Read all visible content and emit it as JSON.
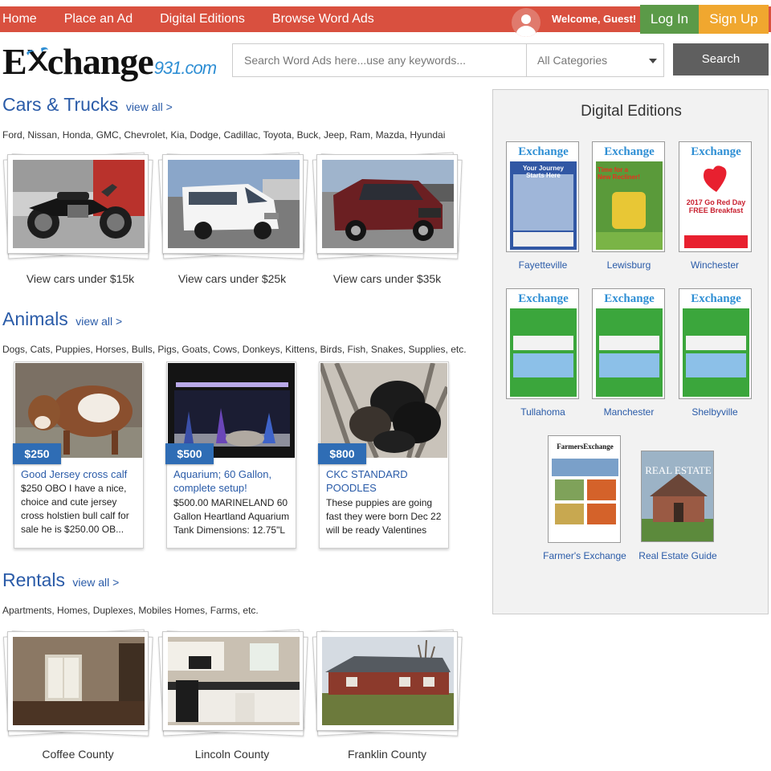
{
  "nav": {
    "items": [
      "Home",
      "Place an Ad",
      "Digital Editions",
      "Browse Word Ads"
    ],
    "welcome": "Welcome, Guest!",
    "login": "Log In",
    "signup": "Sign Up"
  },
  "header": {
    "logo_main_1": "E",
    "logo_main_2": "change",
    "logo_sub": "931.com",
    "search_placeholder": "Search Word Ads here...use any keywords...",
    "category_selected": "All Categories",
    "search_button": "Search"
  },
  "cars": {
    "title": "Cars & Trucks",
    "view_all": "view all >",
    "subtitle": "Ford, Nissan, Honda, GMC, Chevrolet, Kia, Dodge, Cadillac, Toyota, Buck, Jeep, Ram, Mazda, Hyundai",
    "captions": [
      "View cars under $15k",
      "View cars under $25k",
      "View cars under $35k"
    ]
  },
  "animals": {
    "title": "Animals",
    "view_all": "view all >",
    "subtitle": "Dogs, Cats, Puppies, Horses, Bulls, Pigs, Goats, Cows, Donkeys, Kittens, Birds, Fish, Snakes, Supplies, etc.",
    "cards": [
      {
        "price": "$250",
        "title": "Good Jersey cross calf",
        "desc": "$250 OBO I have a nice, choice and cute jersey cross holstien bull calf for sale he is $250.00 OB..."
      },
      {
        "price": "$500",
        "title": "Aquarium; 60 Gallon, complete setup!",
        "desc": "$500.00 MARINELAND 60 Gallon Heartland Aquarium Tank Dimensions: 12.75\"L"
      },
      {
        "price": "$800",
        "title": "CKC STANDARD POODLES",
        "desc": "These puppies are going fast they were born Dec 22 will be ready Valentines"
      }
    ]
  },
  "rentals": {
    "title": "Rentals",
    "view_all": "view all >",
    "subtitle": "Apartments, Homes, Duplexes, Mobiles Homes, Farms, etc.",
    "captions": [
      "Coffee County",
      "Lincoln County",
      "Franklin County"
    ]
  },
  "digital_editions": {
    "title": "Digital Editions",
    "editions": [
      "Fayetteville",
      "Lewisburg",
      "Winchester",
      "Tullahoma",
      "Manchester",
      "Shelbyville",
      "Farmer's Exchange",
      "Real Estate Guide"
    ],
    "cover_brand": "Exchange",
    "farmers_brand": "FarmersExchange",
    "real_estate_brand": "REAL ESTATE",
    "fayetteville_headline": "Your Journey Starts Here",
    "lewisburg_headline": "Time for a New Recliner!",
    "winchester_headline": "2017 Go Red Day FREE Breakfast"
  },
  "colors": {
    "nav_bg": "#d9503f",
    "login_bg": "#5b9a48",
    "signup_bg": "#f0a72f",
    "link": "#2a5ba8",
    "price_badge": "#2f6db5",
    "search_button": "#5f5f5f",
    "logo_accent": "#2f8fd4"
  }
}
